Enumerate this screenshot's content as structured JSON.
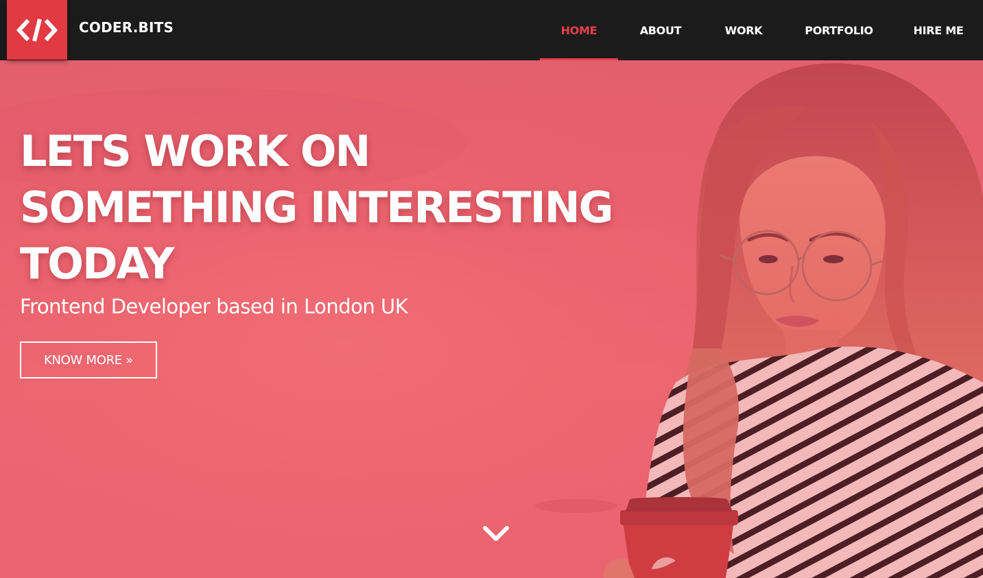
{
  "brand": {
    "logo_icon": "code-brackets-icon",
    "name": "CODER.BITS",
    "accent_color": "#e13a42"
  },
  "nav": {
    "items": [
      {
        "label": "HOME",
        "active": true
      },
      {
        "label": "ABOUT",
        "active": false
      },
      {
        "label": "WORK",
        "active": false
      },
      {
        "label": "PORTFOLIO",
        "active": false
      },
      {
        "label": "HIRE ME",
        "active": false
      }
    ],
    "active_color": "#e8414b"
  },
  "hero": {
    "headline_lines": [
      "LETS WORK ON",
      "SOMETHING INTERESTING",
      "TODAY"
    ],
    "subtitle": "Frontend Developer based in London UK",
    "cta_label": "KNOW MORE »",
    "scroll_icon": "chevron-down-icon",
    "overlay_color": "#e8606f"
  }
}
